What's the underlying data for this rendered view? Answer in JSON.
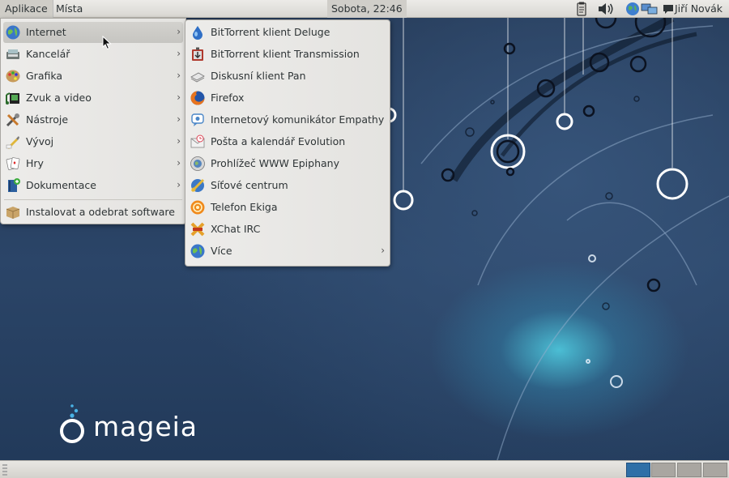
{
  "top_panel": {
    "applications_label": "Aplikace",
    "places_label": "Místa",
    "clock": "Sobota, 22:46",
    "user_name": "Jiří Novák",
    "tray_icons": [
      "clipboard-icon",
      "volume-icon",
      "globe-network-icon",
      "network-icon",
      "chat-icon"
    ]
  },
  "main_menu": {
    "items": [
      {
        "label": "Internet",
        "icon": "internet-globe-icon",
        "has_submenu": true,
        "active": true
      },
      {
        "label": "Kancelář",
        "icon": "office-icon",
        "has_submenu": true
      },
      {
        "label": "Grafika",
        "icon": "graphics-palette-icon",
        "has_submenu": true
      },
      {
        "label": "Zvuk a video",
        "icon": "sound-video-icon",
        "has_submenu": true
      },
      {
        "label": "Nástroje",
        "icon": "tools-icon",
        "has_submenu": true
      },
      {
        "label": "Vývoj",
        "icon": "development-icon",
        "has_submenu": true
      },
      {
        "label": "Hry",
        "icon": "games-cards-icon",
        "has_submenu": true
      },
      {
        "label": "Dokumentace",
        "icon": "documentation-icon",
        "has_submenu": true
      },
      {
        "label": "Instalovat a odebrat software",
        "icon": "package-box-icon",
        "has_submenu": false
      }
    ]
  },
  "sub_menu": {
    "items": [
      {
        "label": "BitTorrent klient Deluge",
        "icon": "deluge-drop-icon"
      },
      {
        "label": "BitTorrent klient Transmission",
        "icon": "transmission-icon"
      },
      {
        "label": "Diskusní klient Pan",
        "icon": "pan-newsreader-icon"
      },
      {
        "label": "Firefox",
        "icon": "firefox-icon"
      },
      {
        "label": "Internetový komunikátor Empathy",
        "icon": "empathy-chat-icon"
      },
      {
        "label": "Pošta a kalendář Evolution",
        "icon": "evolution-mail-icon"
      },
      {
        "label": "Prohlížeč WWW Epiphany",
        "icon": "epiphany-browser-icon"
      },
      {
        "label": "Síťové centrum",
        "icon": "network-center-icon"
      },
      {
        "label": "Telefon Ekiga",
        "icon": "ekiga-phone-icon"
      },
      {
        "label": "XChat IRC",
        "icon": "xchat-icon"
      },
      {
        "label": "Více",
        "icon": "more-globe-icon",
        "has_submenu": true
      }
    ]
  },
  "desktop": {
    "logo_text": "mageia"
  },
  "bottom_panel": {
    "workspaces": [
      "workspace-1",
      "workspace-2",
      "workspace-3",
      "workspace-4"
    ],
    "active_workspace": 1
  },
  "colors": {
    "desktop_blue": "#2b4568",
    "glow": "#5fd3e6",
    "workspace_active": "#2f6fa7"
  }
}
